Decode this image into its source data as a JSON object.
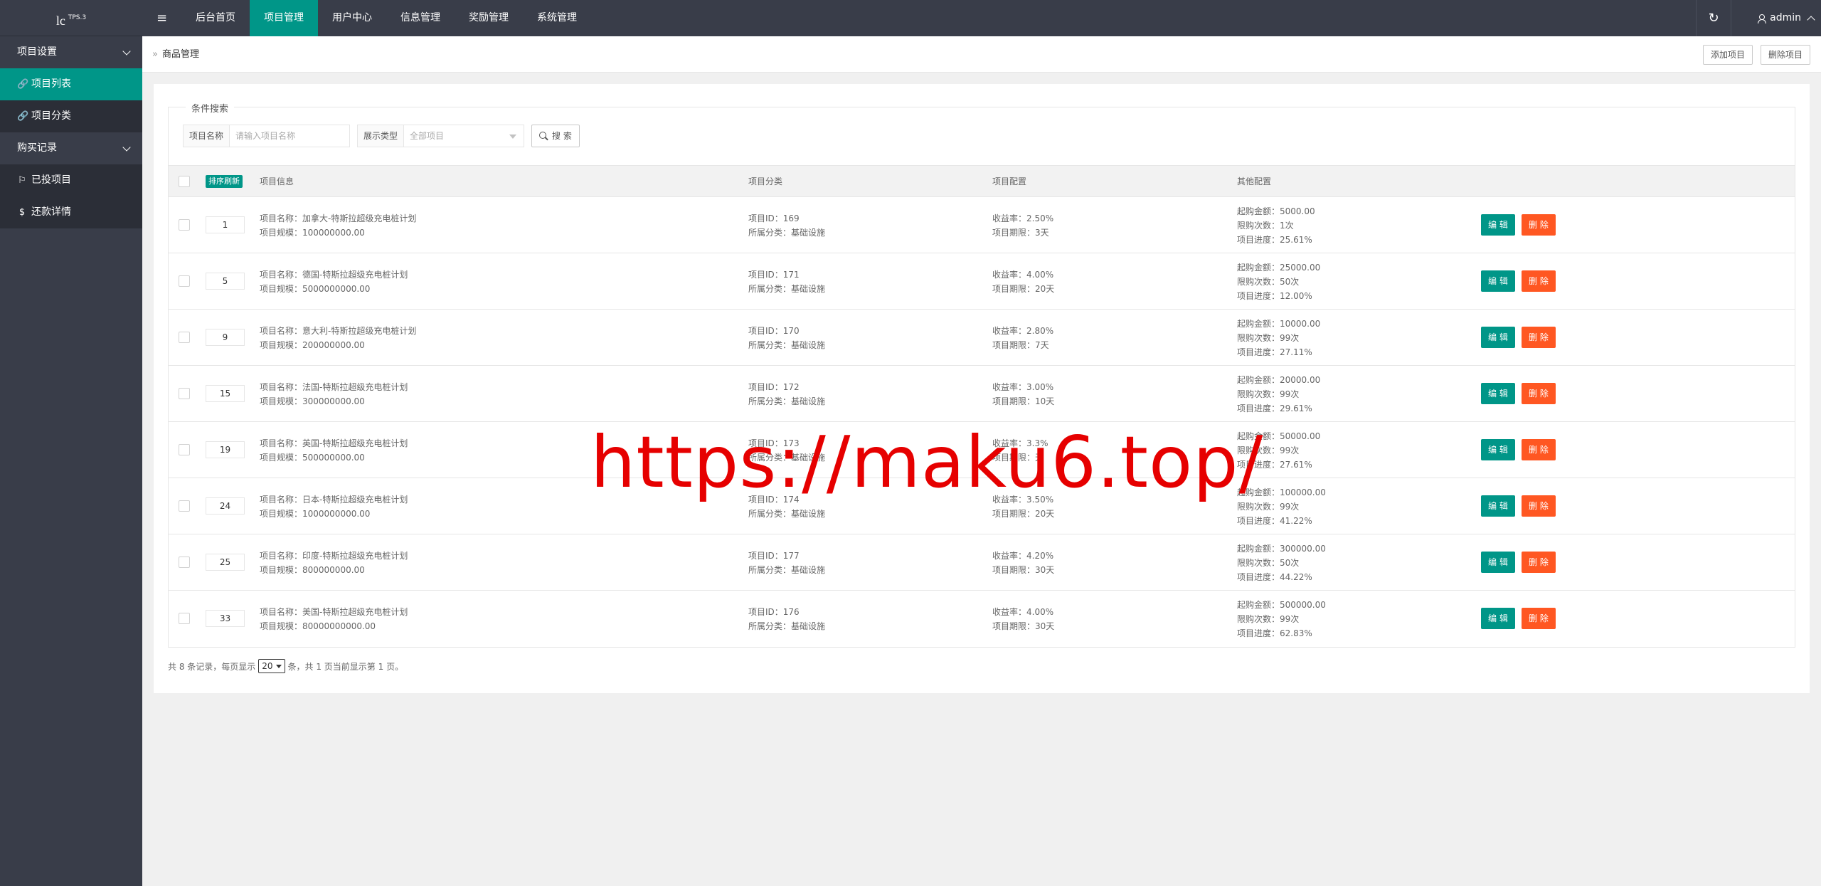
{
  "header": {
    "logo_text": "lc",
    "logo_version": "TPS.3",
    "menu_toggle": "≡",
    "nav": [
      {
        "label": "后台首页",
        "active": false
      },
      {
        "label": "项目管理",
        "active": true
      },
      {
        "label": "用户中心",
        "active": false
      },
      {
        "label": "信息管理",
        "active": false
      },
      {
        "label": "奖励管理",
        "active": false
      },
      {
        "label": "系统管理",
        "active": false
      }
    ],
    "refresh_icon": "↻",
    "user_name": "admin"
  },
  "sidebar": {
    "groups": [
      {
        "label": "项目设置",
        "items": [
          {
            "label": "项目列表",
            "icon": "link-icon",
            "glyph": "🔗",
            "active": true
          },
          {
            "label": "项目分类",
            "icon": "link-icon",
            "glyph": "🔗",
            "active": false
          }
        ]
      },
      {
        "label": "购买记录",
        "items": [
          {
            "label": "已投项目",
            "icon": "flag-icon",
            "glyph": "⚐",
            "active": false
          },
          {
            "label": "还款详情",
            "icon": "dollar-icon",
            "glyph": "$",
            "active": false
          }
        ]
      }
    ]
  },
  "breadcrumb": {
    "separator": "»",
    "title": "商品管理",
    "add_button": "添加项目",
    "delete_button": "删除项目"
  },
  "search": {
    "legend": "条件搜索",
    "name_label": "项目名称",
    "name_placeholder": "请输入项目名称",
    "type_label": "展示类型",
    "type_value": "全部项目",
    "search_button": "搜 索"
  },
  "table": {
    "sort_button": "排序刷新",
    "headers": [
      "项目信息",
      "项目分类",
      "项目配置",
      "其他配置"
    ],
    "edit_label": "编 辑",
    "delete_label": "删 除",
    "rows": [
      {
        "sort": "1",
        "name": "项目名称：加拿大-特斯拉超级充电桩计划",
        "scale": "项目规模：100000000.00",
        "id": "项目ID：169",
        "category": "所属分类：基础设施",
        "rate": "收益率：2.50%",
        "period": "项目期限：3天",
        "min": "起购金额：5000.00",
        "limit": "限购次数：1次",
        "progress": "项目进度：25.61%"
      },
      {
        "sort": "5",
        "name": "项目名称：德国-特斯拉超级充电桩计划",
        "scale": "项目规模：5000000000.00",
        "id": "项目ID：171",
        "category": "所属分类：基础设施",
        "rate": "收益率：4.00%",
        "period": "项目期限：20天",
        "min": "起购金额：25000.00",
        "limit": "限购次数：50次",
        "progress": "项目进度：12.00%"
      },
      {
        "sort": "9",
        "name": "项目名称：意大利-特斯拉超级充电桩计划",
        "scale": "项目规模：200000000.00",
        "id": "项目ID：170",
        "category": "所属分类：基础设施",
        "rate": "收益率：2.80%",
        "period": "项目期限：7天",
        "min": "起购金额：10000.00",
        "limit": "限购次数：99次",
        "progress": "项目进度：27.11%"
      },
      {
        "sort": "15",
        "name": "项目名称：法国-特斯拉超级充电桩计划",
        "scale": "项目规模：300000000.00",
        "id": "项目ID：172",
        "category": "所属分类：基础设施",
        "rate": "收益率：3.00%",
        "period": "项目期限：10天",
        "min": "起购金额：20000.00",
        "limit": "限购次数：99次",
        "progress": "项目进度：29.61%"
      },
      {
        "sort": "19",
        "name": "项目名称：英国-特斯拉超级充电桩计划",
        "scale": "项目规模：500000000.00",
        "id": "项目ID：173",
        "category": "所属分类：基础设施",
        "rate": "收益率：3.3%",
        "period": "项目期限：天",
        "min": "起购金额：50000.00",
        "limit": "限购次数：99次",
        "progress": "项目进度：27.61%"
      },
      {
        "sort": "24",
        "name": "项目名称：日本-特斯拉超级充电桩计划",
        "scale": "项目规模：1000000000.00",
        "id": "项目ID：174",
        "category": "所属分类：基础设施",
        "rate": "收益率：3.50%",
        "period": "项目期限：20天",
        "min": "起购金额：100000.00",
        "limit": "限购次数：99次",
        "progress": "项目进度：41.22%"
      },
      {
        "sort": "25",
        "name": "项目名称：印度-特斯拉超级充电桩计划",
        "scale": "项目规模：800000000.00",
        "id": "项目ID：177",
        "category": "所属分类：基础设施",
        "rate": "收益率：4.20%",
        "period": "项目期限：30天",
        "min": "起购金额：300000.00",
        "limit": "限购次数：50次",
        "progress": "项目进度：44.22%"
      },
      {
        "sort": "33",
        "name": "项目名称：美国-特斯拉超级充电桩计划",
        "scale": "项目规模：80000000000.00",
        "id": "项目ID：176",
        "category": "所属分类：基础设施",
        "rate": "收益率：4.00%",
        "period": "项目期限：30天",
        "min": "起购金额：500000.00",
        "limit": "限购次数：99次",
        "progress": "项目进度：62.83%"
      }
    ]
  },
  "pager": {
    "prefix": "共 8 条记录，每页显示",
    "page_size": "20",
    "suffix": "条，共 1 页当前显示第 1 页。"
  },
  "watermark": "https://maku6.top/",
  "colors": {
    "dark": "#393d49",
    "accent": "#009688",
    "danger": "#ff5722",
    "watermark": "#e60000"
  }
}
